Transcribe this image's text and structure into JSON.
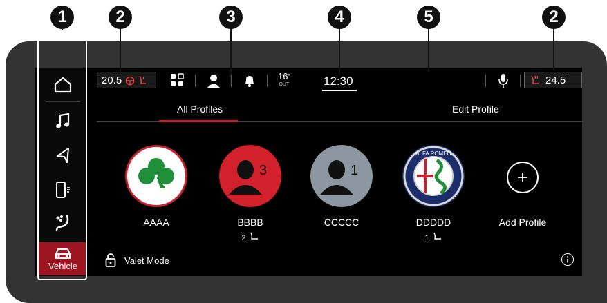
{
  "callouts": [
    "1",
    "2",
    "3",
    "4",
    "5",
    "2"
  ],
  "sidebar": {
    "vehicle_label": "Vehicle"
  },
  "topbar": {
    "left_temp": "20.5",
    "right_temp": "24.5",
    "outside_temp": "16",
    "outside_label": "OUT",
    "clock": "12:30"
  },
  "tabs": {
    "all_profiles": "All Profiles",
    "edit_profile": "Edit Profile"
  },
  "profiles": [
    {
      "name": "AAAA"
    },
    {
      "name": "BBBB",
      "badge": "3",
      "seat": "2"
    },
    {
      "name": "CCCCC",
      "badge": "1"
    },
    {
      "name": "DDDDD",
      "seat": "1"
    },
    {
      "name": "Add Profile"
    }
  ],
  "valet": {
    "label": "Valet Mode"
  },
  "colors": {
    "accent": "#9c1520",
    "tab_red": "#c4222c",
    "profile_red": "#d3212b",
    "profile_gray": "#8d97a1",
    "clover_green": "#1f8f3a"
  }
}
